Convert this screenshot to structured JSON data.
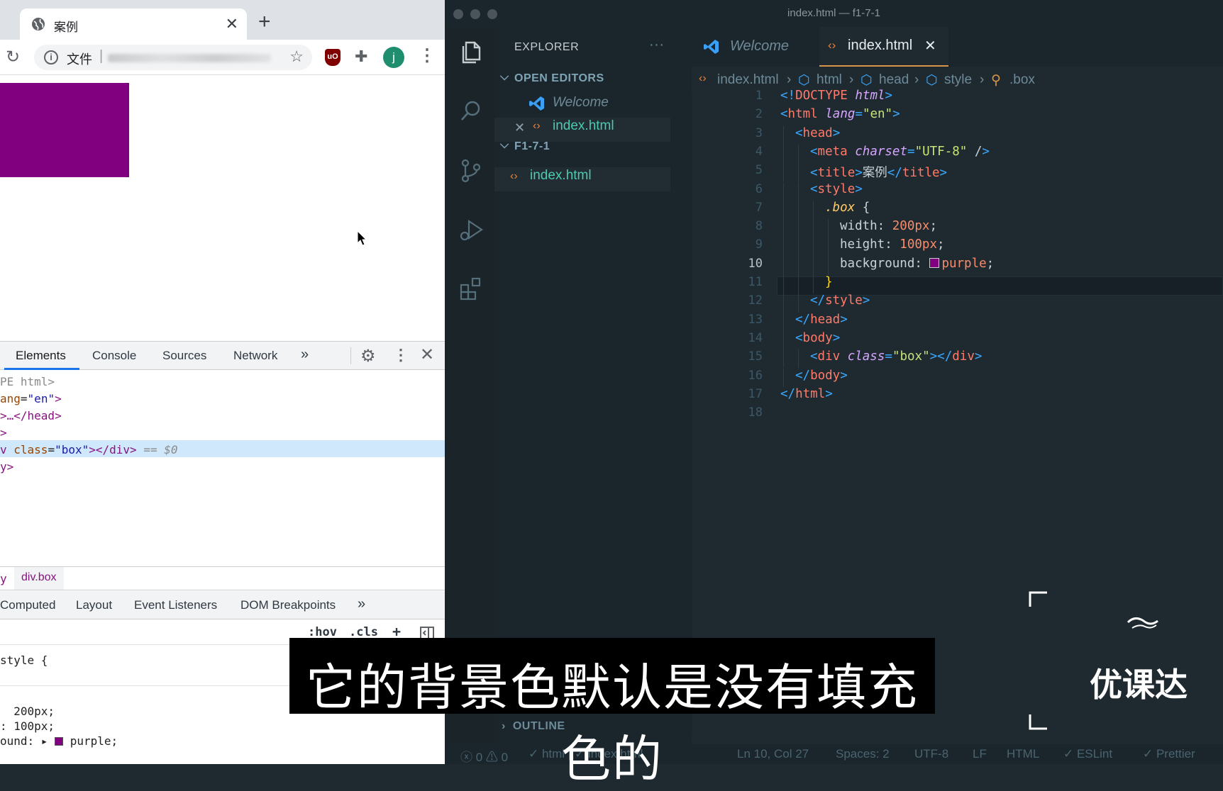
{
  "browser": {
    "tab_title": "案例",
    "address_scheme": "文件",
    "avatar_letter": "j",
    "ublock_label": "uO",
    "devtools": {
      "tabs": [
        "Elements",
        "Console",
        "Sources",
        "Network"
      ],
      "more_tabs": "»",
      "dom_lines": [
        {
          "a": "PE html>",
          "b": "",
          "c": "",
          "d": ""
        },
        {
          "a": "ang",
          "b": "=",
          "c": "\"en\"",
          "d": ">"
        },
        {
          "a": ">…</head>",
          "b": "",
          "c": "",
          "d": ""
        },
        {
          "a": ">",
          "b": "",
          "c": "",
          "d": ""
        },
        {
          "a": "v ",
          "b": "class",
          "c": "\"box\"",
          "d": "></div>",
          "e": " == $0"
        },
        {
          "a": "y>",
          "b": "",
          "c": "",
          "d": ""
        }
      ],
      "breadcrumb_prev": "y",
      "breadcrumb_current": "div.box",
      "sub_tabs": [
        "Computed",
        "Layout",
        "Event Listeners",
        "DOM Breakpoints"
      ],
      "sub_more": "»",
      "filter_hov": ":hov",
      "filter_cls": ".cls",
      "filter_plus": "+",
      "style_lines": [
        "style {",
        "  200px;",
        ": 100px;",
        "ound: ▸ purple;"
      ]
    }
  },
  "vscode": {
    "window_title": "index.html — f1-7-1",
    "explorer_title": "EXPLORER",
    "explorer_more": "···",
    "open_editors_label": "OPEN EDITORS",
    "open_editors": [
      "Welcome",
      "index.html"
    ],
    "folder_label": "F1-7-1",
    "folder_files": [
      "index.html"
    ],
    "outline_label": "OUTLINE",
    "tabs": [
      {
        "label": "Welcome",
        "active": false
      },
      {
        "label": "index.html",
        "active": true
      }
    ],
    "breadcrumbs": [
      "index.html",
      "html",
      "head",
      "style",
      ".box"
    ],
    "code_lines": [
      "<!DOCTYPE html>",
      "<html lang=\"en\">",
      "<head>",
      "<meta charset=\"UTF-8\" />",
      "<title>案例</title>",
      "<style>",
      ".box {",
      "width: 200px;",
      "height: 100px;",
      "background: purple;",
      "}",
      "</style>",
      "</head>",
      "<body>",
      "<div class=\"box\"></div>",
      "</body>",
      "</html>",
      ""
    ],
    "line_numbers": [
      "1",
      "2",
      "3",
      "4",
      "5",
      "6",
      "7",
      "8",
      "9",
      "10",
      "11",
      "12",
      "13",
      "14",
      "15",
      "16",
      "17",
      "18"
    ],
    "active_line": "10",
    "status": {
      "errors": "0",
      "warnings": "0",
      "html_check": "html | ✓ index.html",
      "position": "Ln 10, Col 27",
      "spaces": "Spaces: 2",
      "encoding": "UTF-8",
      "eol": "LF",
      "language": "HTML",
      "eslint": "ESLint",
      "prettier": "Prettier"
    }
  },
  "overlay": {
    "subtitle": "它的背景色默认是没有填充色的",
    "watermark": "优课达"
  },
  "colors": {
    "box_purple": "#800080",
    "vscode_bg": "#1f2a30"
  }
}
